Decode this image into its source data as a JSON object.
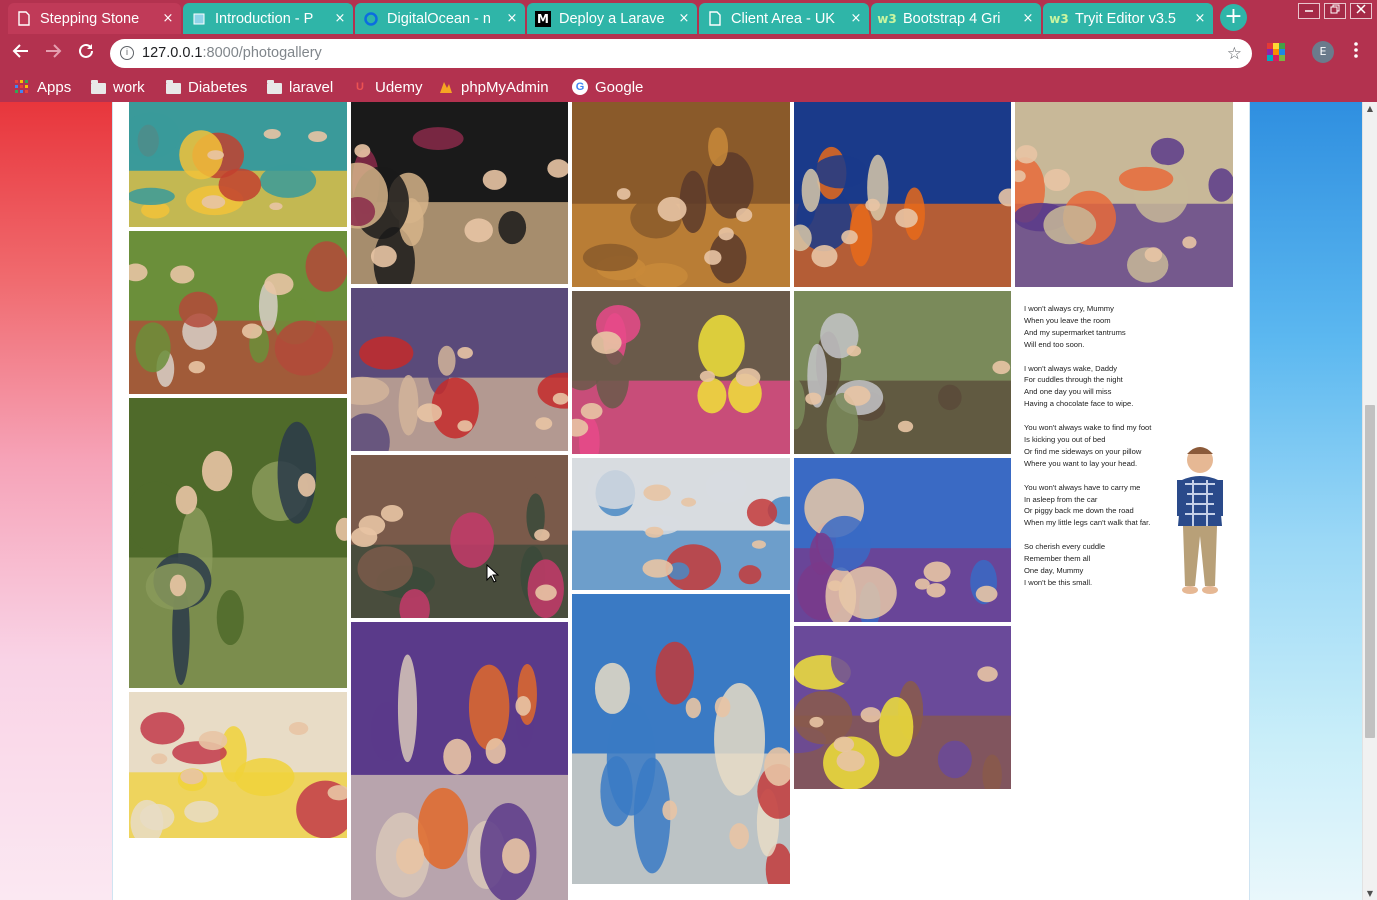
{
  "browser": {
    "tabs": [
      {
        "title": "Stepping Stone",
        "favicon": "page-icon",
        "active": true
      },
      {
        "title": "Introduction - P",
        "favicon": "cube-icon",
        "active": false
      },
      {
        "title": "DigitalOcean - n",
        "favicon": "digitalocean-icon",
        "active": false
      },
      {
        "title": "Deploy a Larave",
        "favicon": "medium-icon",
        "active": false
      },
      {
        "title": "Client Area - UK",
        "favicon": "page-icon",
        "active": false
      },
      {
        "title": "Bootstrap 4 Gri",
        "favicon": "w3schools-icon",
        "active": false
      },
      {
        "title": "Tryit Editor v3.5",
        "favicon": "w3schools-icon",
        "active": false
      }
    ],
    "tab_close_glyph": "×",
    "new_tab_glyph": "+",
    "url_host": "127.0.0.1",
    "url_path": ":8000/photogallery",
    "profile_initial": "E",
    "bookmarks": [
      {
        "label": "Apps",
        "icon": "apps-grid-icon"
      },
      {
        "label": "work",
        "icon": "folder-icon"
      },
      {
        "label": "Diabetes",
        "icon": "folder-icon"
      },
      {
        "label": "laravel",
        "icon": "folder-icon"
      },
      {
        "label": "Udemy",
        "icon": "udemy-icon"
      },
      {
        "label": "phpMyAdmin",
        "icon": "phpmyadmin-icon"
      },
      {
        "label": "Google",
        "icon": "google-icon"
      }
    ]
  },
  "gallery": {
    "photos": [
      {
        "name": "photo-toys-playroom",
        "colors": [
          "#3a9a9a",
          "#f2c23a",
          "#c2412f"
        ]
      },
      {
        "name": "photo-garden-group",
        "colors": [
          "#6b8f3a",
          "#b34a3a",
          "#d8d0c8"
        ]
      },
      {
        "name": "photo-woodland-walk",
        "colors": [
          "#4f6a2a",
          "#8a9a5a",
          "#2a3a4a"
        ]
      },
      {
        "name": "photo-play-tent",
        "colors": [
          "#e8dcc6",
          "#f0d23a",
          "#c23a4a"
        ]
      },
      {
        "name": "photo-christmas-tree",
        "colors": [
          "#1a1a1a",
          "#d6b48a",
          "#8a2a4a"
        ]
      },
      {
        "name": "photo-lizard-handling",
        "colors": [
          "#5a4a7a",
          "#d2b49a",
          "#c42a2a"
        ]
      },
      {
        "name": "photo-group-outside-building",
        "colors": [
          "#7a5a4a",
          "#3a4a3a",
          "#c43a6a"
        ]
      },
      {
        "name": "photo-pumpkin-carving",
        "colors": [
          "#5a3a8a",
          "#d8c8b8",
          "#e06a2a"
        ]
      },
      {
        "name": "photo-autumn-leaves",
        "colors": [
          "#8a5a2a",
          "#c88a3a",
          "#5a3a2a"
        ]
      },
      {
        "name": "photo-flower-costumes",
        "colors": [
          "#6a5a4a",
          "#e84a8a",
          "#f0e23a"
        ]
      },
      {
        "name": "photo-classroom-display",
        "colors": [
          "#d8dce0",
          "#4a8ac4",
          "#c43a3a"
        ]
      },
      {
        "name": "photo-drawing-table",
        "colors": [
          "#3a7ac4",
          "#e8dcc6",
          "#c23a3a"
        ]
      },
      {
        "name": "photo-sensory-tray",
        "colors": [
          "#1a3a8a",
          "#e86a1a",
          "#d8c8a8"
        ]
      },
      {
        "name": "photo-playground-balance",
        "colors": [
          "#7a8a5a",
          "#5a4a3a",
          "#c4c4c8"
        ]
      },
      {
        "name": "photo-snack-table",
        "colors": [
          "#3a6ac4",
          "#7a3a8a",
          "#e8c8a8"
        ]
      },
      {
        "name": "photo-staff-and-children",
        "colors": [
          "#6a4a9a",
          "#8a5a4a",
          "#f0e23a"
        ]
      },
      {
        "name": "photo-painting-tray",
        "colors": [
          "#c8b898",
          "#5a3a8a",
          "#e86a3a"
        ]
      }
    ],
    "poem_lines": [
      "I won't always cry, Mummy",
      "When you leave the room",
      "And my supermarket tantrums",
      "Will end too soon.",
      "",
      "I won't always wake, Daddy",
      "For cuddles through the night",
      "And one day you will miss",
      "Having a chocolate face to wipe.",
      "",
      "You won't always wake to find my foot",
      "Is kicking you out of bed",
      "Or find me sideways on your pillow",
      "Where you want to lay your head.",
      "",
      "You won't always have to carry me",
      "In asleep from the car",
      "Or piggy back me down the road",
      "When my little legs can't walk that far.",
      "",
      "So cherish every cuddle",
      "Remember them all",
      "One day, Mummy",
      "I won't be this small."
    ]
  }
}
